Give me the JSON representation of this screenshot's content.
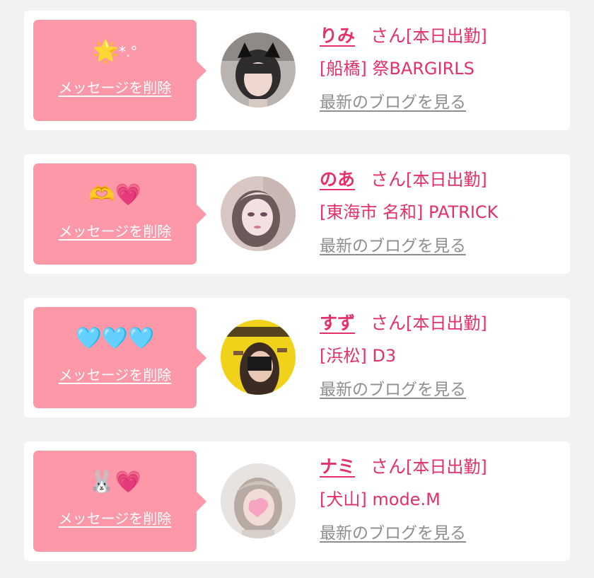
{
  "labels": {
    "delete": "メッセージを削除",
    "san": "さん",
    "status": "[本日出勤]",
    "blog": "最新のブログを見る"
  },
  "items": [
    {
      "name": "りみ",
      "area": "[船橋]",
      "shop": "祭BARGIRLS",
      "emoji": [
        "🌟",
        "*.°"
      ],
      "avatar_icon": "cat-ear-girl-photo"
    },
    {
      "name": "のあ",
      "area": "[東海市 名和]",
      "shop": "PATRICK",
      "emoji": [
        "🫶",
        "💗"
      ],
      "avatar_icon": "girl-photo"
    },
    {
      "name": "すず",
      "area": "[浜松]",
      "shop": "D3",
      "emoji": [
        "🩵",
        "🩵",
        "🩵"
      ],
      "avatar_icon": "magazine-cover-photo"
    },
    {
      "name": "ナミ",
      "area": "[犬山]",
      "shop": "mode.M",
      "emoji": [
        "🐰",
        "💗"
      ],
      "avatar_icon": "girl-heart-photo"
    }
  ],
  "colors": {
    "bubble": "#fc98a8",
    "accent": "#e5306a",
    "link_gray": "#8e8e8e",
    "background": "#f2f2f2"
  }
}
